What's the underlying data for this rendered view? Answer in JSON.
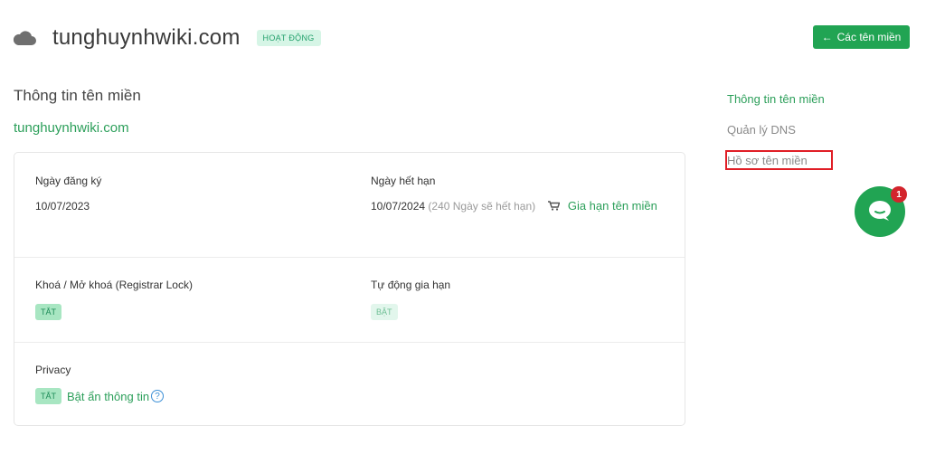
{
  "header": {
    "domain": "tunghuynhwiki.com",
    "status": "HOẠT ĐỘNG",
    "back_button": "Các tên miền",
    "cloud_icon": "cloud-icon"
  },
  "section": {
    "title": "Thông tin tên miền",
    "domain_link": "tunghuynhwiki.com"
  },
  "details": {
    "registered_label": "Ngày đăng ký",
    "registered_value": "10/07/2023",
    "expiry_label": "Ngày hết hạn",
    "expiry_value": "10/07/2024",
    "expiry_remaining": "(240 Ngày sẽ hết hạn)",
    "renew_link": "Gia hạn tên miền",
    "lock_label": "Khoá / Mở khoá (Registrar Lock)",
    "lock_status": "TẮT",
    "autorenew_label": "Tự động gia hạn",
    "autorenew_status": "BẬT",
    "privacy_label": "Privacy",
    "privacy_status": "TẮT",
    "privacy_link": "Bật ẩn thông tin",
    "help_symbol": "?"
  },
  "side_nav": {
    "items": [
      {
        "label": "Thông tin tên miền",
        "state": "active"
      },
      {
        "label": "Quản lý DNS",
        "state": "default"
      },
      {
        "label": "Hồ sơ tên miền",
        "state": "highlighted"
      }
    ]
  },
  "chat": {
    "badge_count": "1",
    "icon": "chat-bubble-icon"
  },
  "colors": {
    "brand_green": "#21a453",
    "link_green": "#2c9f5a",
    "highlight_red": "#e01e26",
    "badge_red": "#d3242c"
  }
}
